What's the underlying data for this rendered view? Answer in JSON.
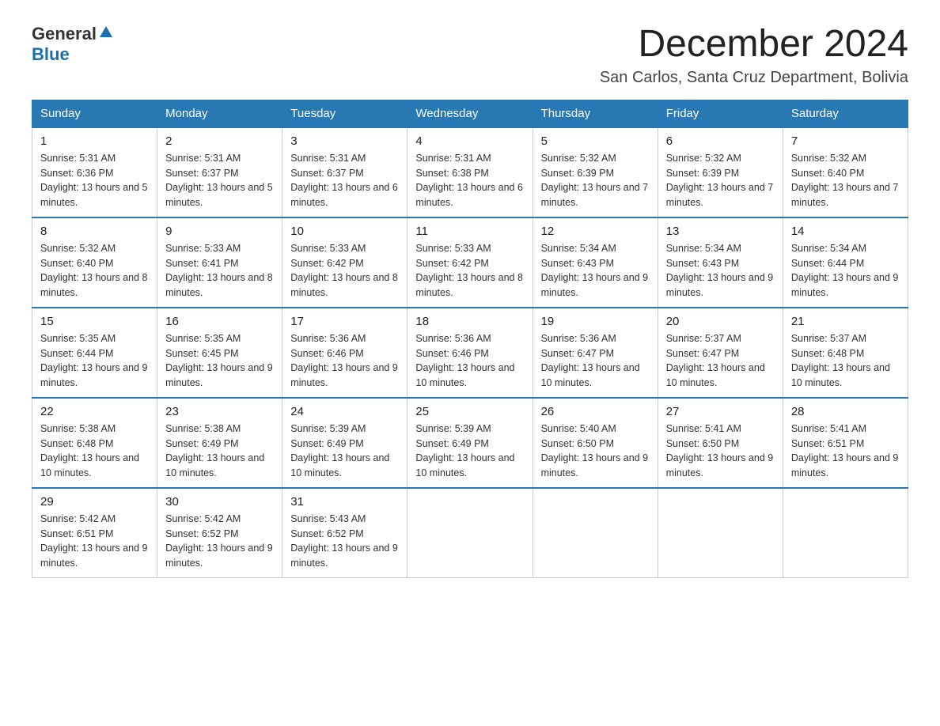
{
  "header": {
    "logo_general": "General",
    "logo_blue": "Blue",
    "month_title": "December 2024",
    "location": "San Carlos, Santa Cruz Department, Bolivia"
  },
  "days_of_week": [
    "Sunday",
    "Monday",
    "Tuesday",
    "Wednesday",
    "Thursday",
    "Friday",
    "Saturday"
  ],
  "weeks": [
    [
      {
        "day": "1",
        "sunrise": "5:31 AM",
        "sunset": "6:36 PM",
        "daylight": "13 hours and 5 minutes."
      },
      {
        "day": "2",
        "sunrise": "5:31 AM",
        "sunset": "6:37 PM",
        "daylight": "13 hours and 5 minutes."
      },
      {
        "day": "3",
        "sunrise": "5:31 AM",
        "sunset": "6:37 PM",
        "daylight": "13 hours and 6 minutes."
      },
      {
        "day": "4",
        "sunrise": "5:31 AM",
        "sunset": "6:38 PM",
        "daylight": "13 hours and 6 minutes."
      },
      {
        "day": "5",
        "sunrise": "5:32 AM",
        "sunset": "6:39 PM",
        "daylight": "13 hours and 7 minutes."
      },
      {
        "day": "6",
        "sunrise": "5:32 AM",
        "sunset": "6:39 PM",
        "daylight": "13 hours and 7 minutes."
      },
      {
        "day": "7",
        "sunrise": "5:32 AM",
        "sunset": "6:40 PM",
        "daylight": "13 hours and 7 minutes."
      }
    ],
    [
      {
        "day": "8",
        "sunrise": "5:32 AM",
        "sunset": "6:40 PM",
        "daylight": "13 hours and 8 minutes."
      },
      {
        "day": "9",
        "sunrise": "5:33 AM",
        "sunset": "6:41 PM",
        "daylight": "13 hours and 8 minutes."
      },
      {
        "day": "10",
        "sunrise": "5:33 AM",
        "sunset": "6:42 PM",
        "daylight": "13 hours and 8 minutes."
      },
      {
        "day": "11",
        "sunrise": "5:33 AM",
        "sunset": "6:42 PM",
        "daylight": "13 hours and 8 minutes."
      },
      {
        "day": "12",
        "sunrise": "5:34 AM",
        "sunset": "6:43 PM",
        "daylight": "13 hours and 9 minutes."
      },
      {
        "day": "13",
        "sunrise": "5:34 AM",
        "sunset": "6:43 PM",
        "daylight": "13 hours and 9 minutes."
      },
      {
        "day": "14",
        "sunrise": "5:34 AM",
        "sunset": "6:44 PM",
        "daylight": "13 hours and 9 minutes."
      }
    ],
    [
      {
        "day": "15",
        "sunrise": "5:35 AM",
        "sunset": "6:44 PM",
        "daylight": "13 hours and 9 minutes."
      },
      {
        "day": "16",
        "sunrise": "5:35 AM",
        "sunset": "6:45 PM",
        "daylight": "13 hours and 9 minutes."
      },
      {
        "day": "17",
        "sunrise": "5:36 AM",
        "sunset": "6:46 PM",
        "daylight": "13 hours and 9 minutes."
      },
      {
        "day": "18",
        "sunrise": "5:36 AM",
        "sunset": "6:46 PM",
        "daylight": "13 hours and 10 minutes."
      },
      {
        "day": "19",
        "sunrise": "5:36 AM",
        "sunset": "6:47 PM",
        "daylight": "13 hours and 10 minutes."
      },
      {
        "day": "20",
        "sunrise": "5:37 AM",
        "sunset": "6:47 PM",
        "daylight": "13 hours and 10 minutes."
      },
      {
        "day": "21",
        "sunrise": "5:37 AM",
        "sunset": "6:48 PM",
        "daylight": "13 hours and 10 minutes."
      }
    ],
    [
      {
        "day": "22",
        "sunrise": "5:38 AM",
        "sunset": "6:48 PM",
        "daylight": "13 hours and 10 minutes."
      },
      {
        "day": "23",
        "sunrise": "5:38 AM",
        "sunset": "6:49 PM",
        "daylight": "13 hours and 10 minutes."
      },
      {
        "day": "24",
        "sunrise": "5:39 AM",
        "sunset": "6:49 PM",
        "daylight": "13 hours and 10 minutes."
      },
      {
        "day": "25",
        "sunrise": "5:39 AM",
        "sunset": "6:49 PM",
        "daylight": "13 hours and 10 minutes."
      },
      {
        "day": "26",
        "sunrise": "5:40 AM",
        "sunset": "6:50 PM",
        "daylight": "13 hours and 9 minutes."
      },
      {
        "day": "27",
        "sunrise": "5:41 AM",
        "sunset": "6:50 PM",
        "daylight": "13 hours and 9 minutes."
      },
      {
        "day": "28",
        "sunrise": "5:41 AM",
        "sunset": "6:51 PM",
        "daylight": "13 hours and 9 minutes."
      }
    ],
    [
      {
        "day": "29",
        "sunrise": "5:42 AM",
        "sunset": "6:51 PM",
        "daylight": "13 hours and 9 minutes."
      },
      {
        "day": "30",
        "sunrise": "5:42 AM",
        "sunset": "6:52 PM",
        "daylight": "13 hours and 9 minutes."
      },
      {
        "day": "31",
        "sunrise": "5:43 AM",
        "sunset": "6:52 PM",
        "daylight": "13 hours and 9 minutes."
      },
      null,
      null,
      null,
      null
    ]
  ],
  "labels": {
    "sunrise_prefix": "Sunrise: ",
    "sunset_prefix": "Sunset: ",
    "daylight_prefix": "Daylight: "
  }
}
